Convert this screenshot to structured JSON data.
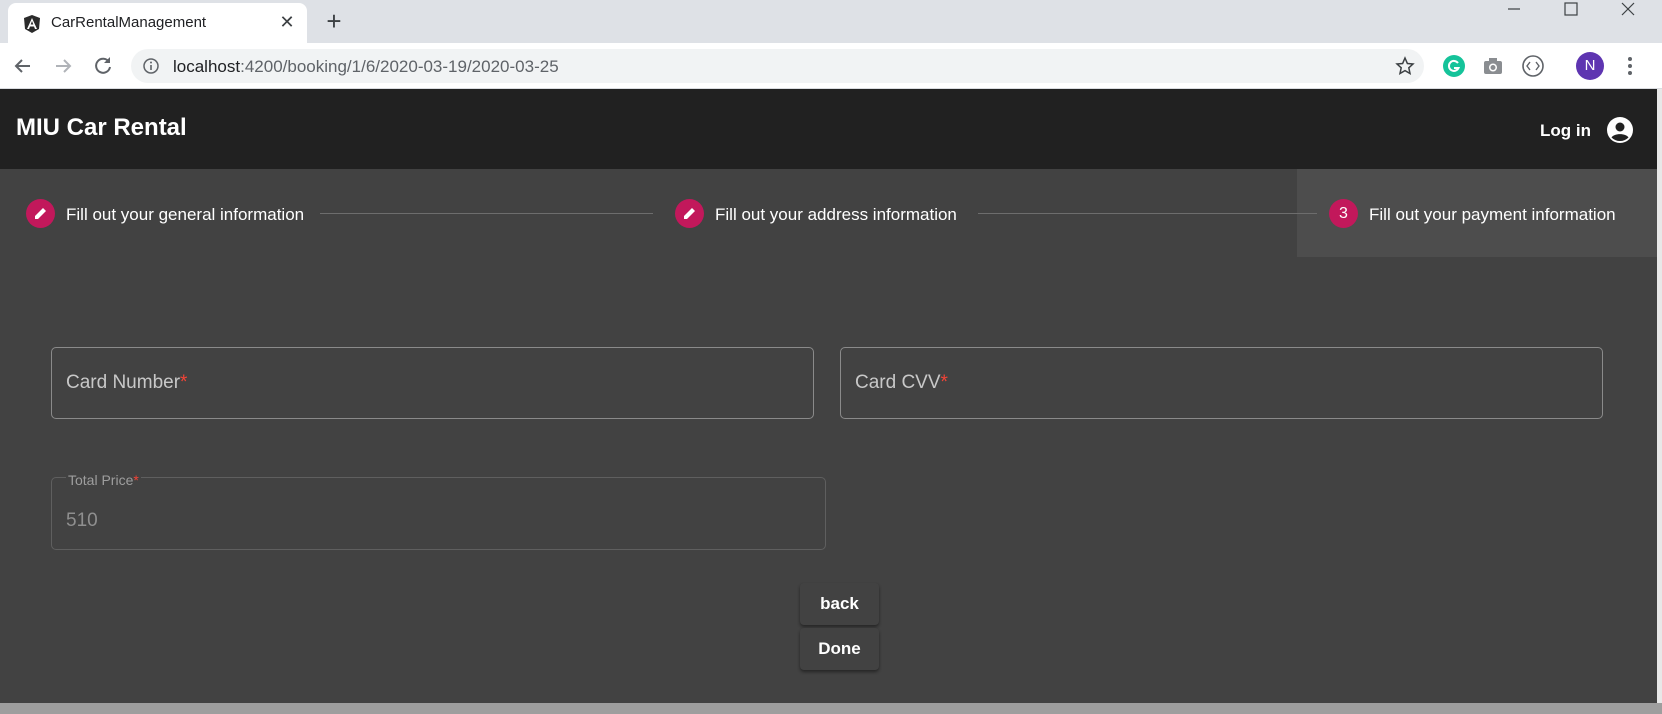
{
  "browser": {
    "tab_title": "CarRentalManagement",
    "url_host": "localhost",
    "url_rest": ":4200/booking/1/6/2020-03-19/2020-03-25",
    "profile_initial": "N"
  },
  "app": {
    "title": "MIU Car Rental",
    "login_label": "Log in"
  },
  "stepper": {
    "steps": [
      {
        "label": "Fill out your general information",
        "icon": "edit-icon",
        "state": "edit"
      },
      {
        "label": "Fill out your address information",
        "icon": "edit-icon",
        "state": "edit"
      },
      {
        "label": "Fill out your payment information",
        "number": "3",
        "state": "active"
      }
    ]
  },
  "form": {
    "card_number_label": "Card Number",
    "card_cvv_label": "Card CVV",
    "total_price_label": "Total Price",
    "total_price_value": "510",
    "required_mark": "*"
  },
  "buttons": {
    "back_label": "back",
    "done_label": "Done"
  },
  "colors": {
    "accent": "#c2185b",
    "appbar": "#212121",
    "background": "#424242"
  }
}
